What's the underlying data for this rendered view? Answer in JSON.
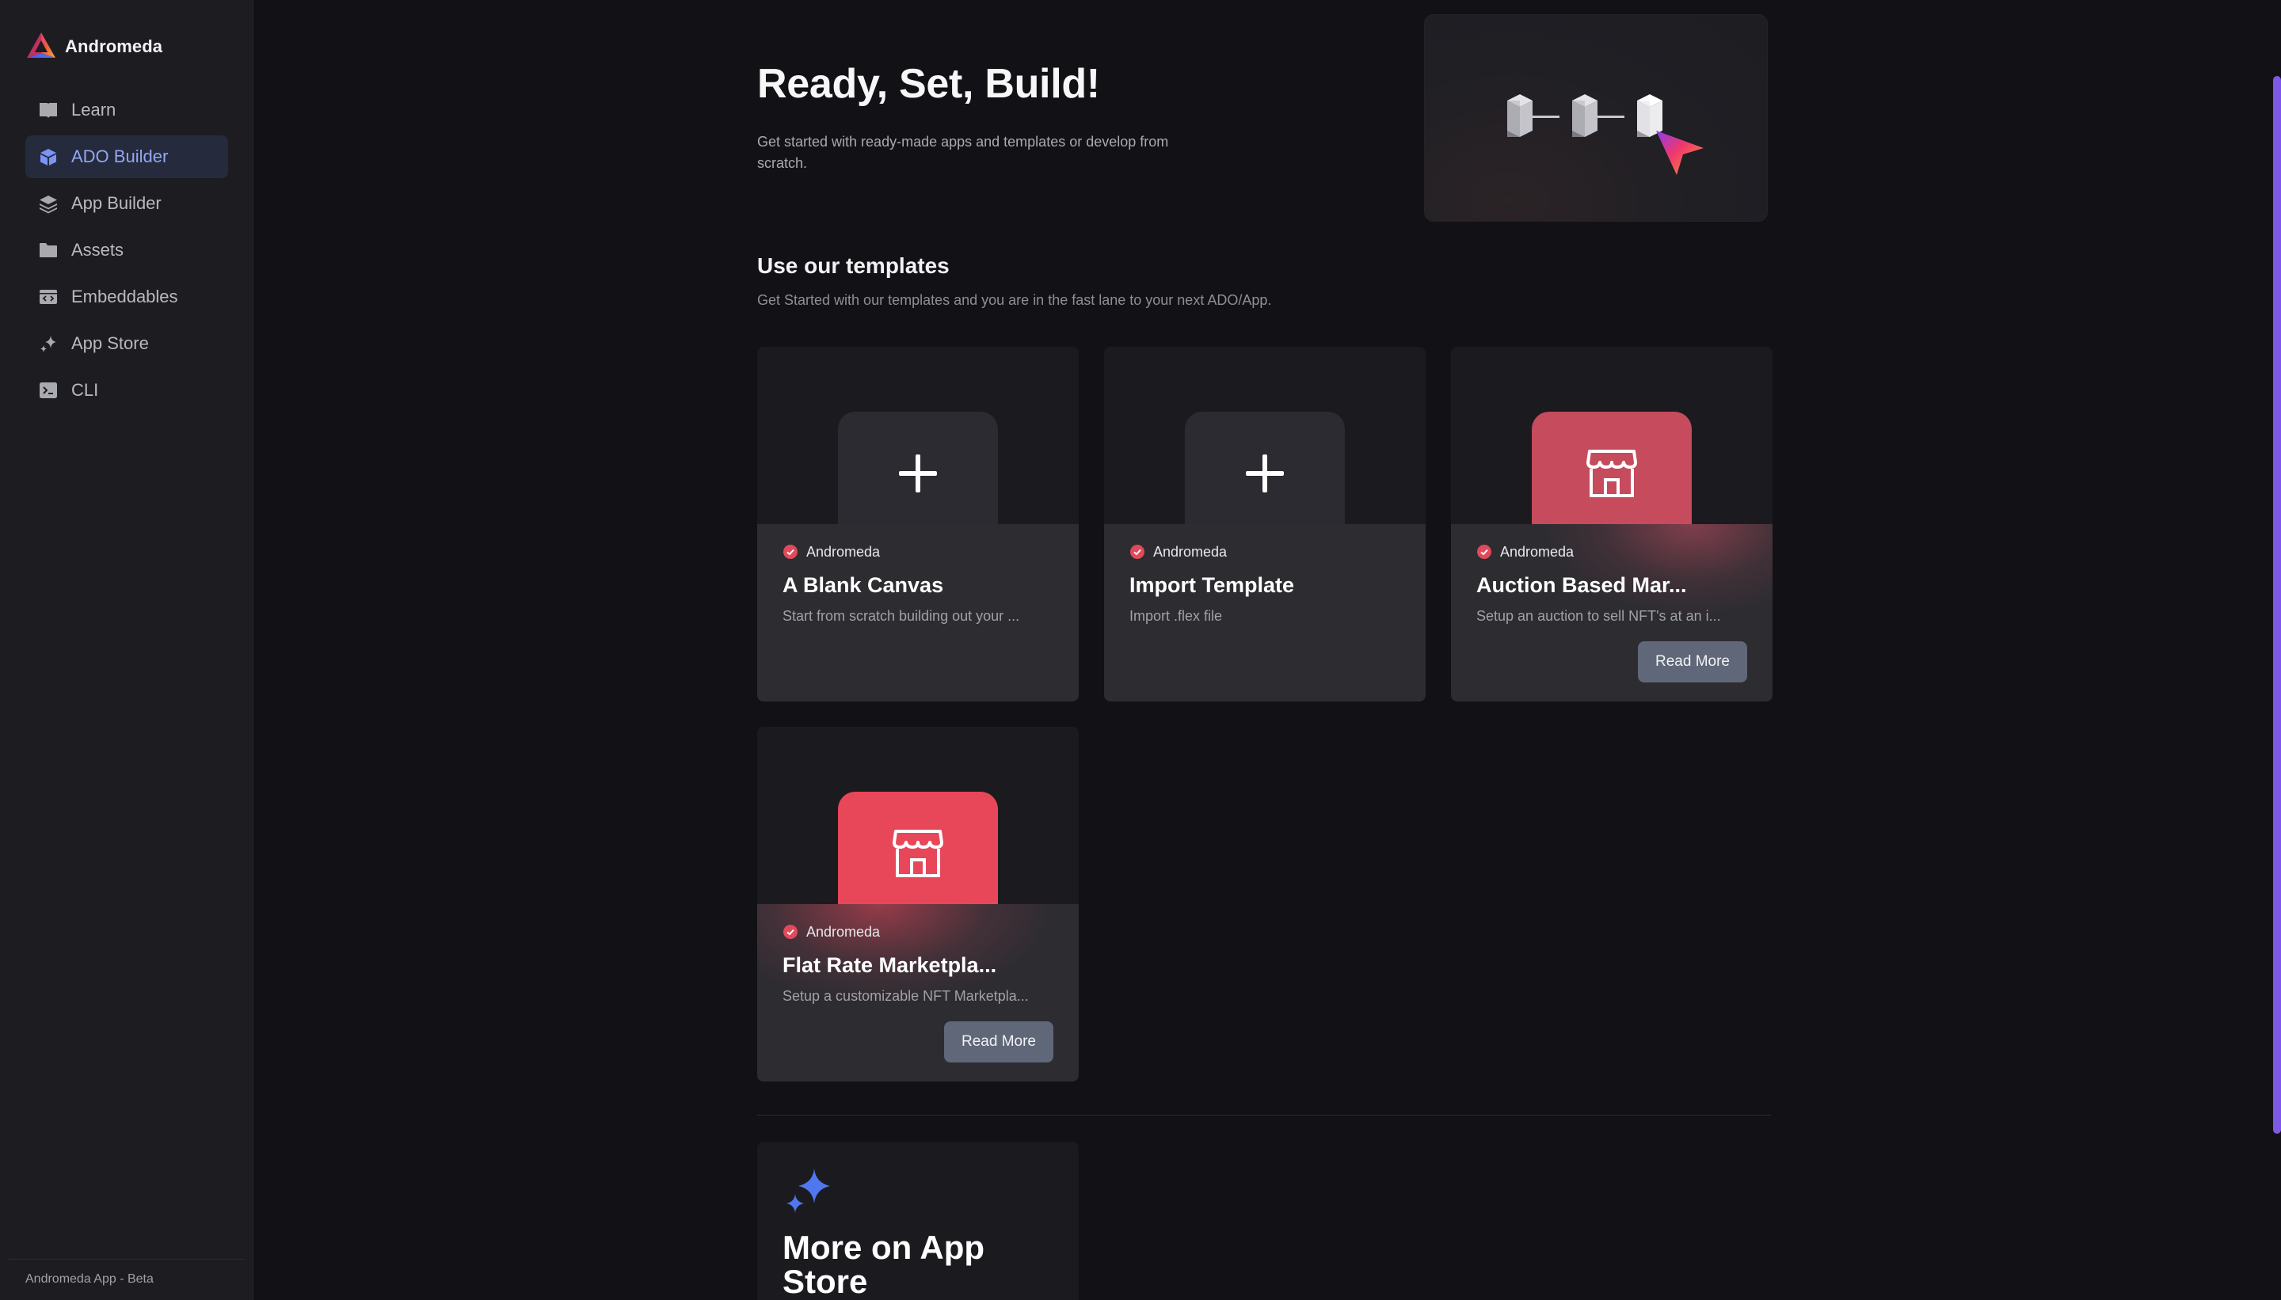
{
  "app": {
    "name": "Andromeda",
    "footer": "Andromeda App - Beta"
  },
  "sidebar": {
    "items": [
      {
        "label": "Learn",
        "icon": "book-icon",
        "active": false
      },
      {
        "label": "ADO Builder",
        "icon": "cube-icon",
        "active": true
      },
      {
        "label": "App Builder",
        "icon": "layers-icon",
        "active": false
      },
      {
        "label": "Assets",
        "icon": "folder-icon",
        "active": false
      },
      {
        "label": "Embeddables",
        "icon": "embed-icon",
        "active": false
      },
      {
        "label": "App Store",
        "icon": "sparkles-icon",
        "active": false
      },
      {
        "label": "CLI",
        "icon": "terminal-icon",
        "active": false
      }
    ]
  },
  "hero": {
    "title": "Ready, Set, Build!",
    "subtitle": "Get started with ready-made apps and templates or develop from scratch."
  },
  "templates": {
    "title": "Use our templates",
    "subtitle": "Get Started with our templates and you are in the fast lane to your next ADO/App.",
    "cards": [
      {
        "author": "Andromeda",
        "title": "A Blank Canvas",
        "description": "Start from scratch building out your ...",
        "icon": "plus-icon",
        "read_more": null
      },
      {
        "author": "Andromeda",
        "title": "Import Template",
        "description": "Import .flex file",
        "icon": "plus-icon",
        "read_more": null
      },
      {
        "author": "Andromeda",
        "title": "Auction Based Mar...",
        "description": "Setup an auction to sell NFT's at an i...",
        "icon": "storefront-icon",
        "read_more": "Read More"
      },
      {
        "author": "Andromeda",
        "title": "Flat Rate Marketpla...",
        "description": "Setup a customizable NFT Marketpla...",
        "icon": "storefront-icon",
        "read_more": "Read More"
      }
    ]
  },
  "app_store": {
    "title": "More on App Store",
    "icon": "sparkles-icon"
  },
  "colors": {
    "accent": "#7c94f5",
    "card_red": "#c54b5d",
    "card_red_bright": "#e8475a",
    "scrollbar": "#7e59e8"
  }
}
